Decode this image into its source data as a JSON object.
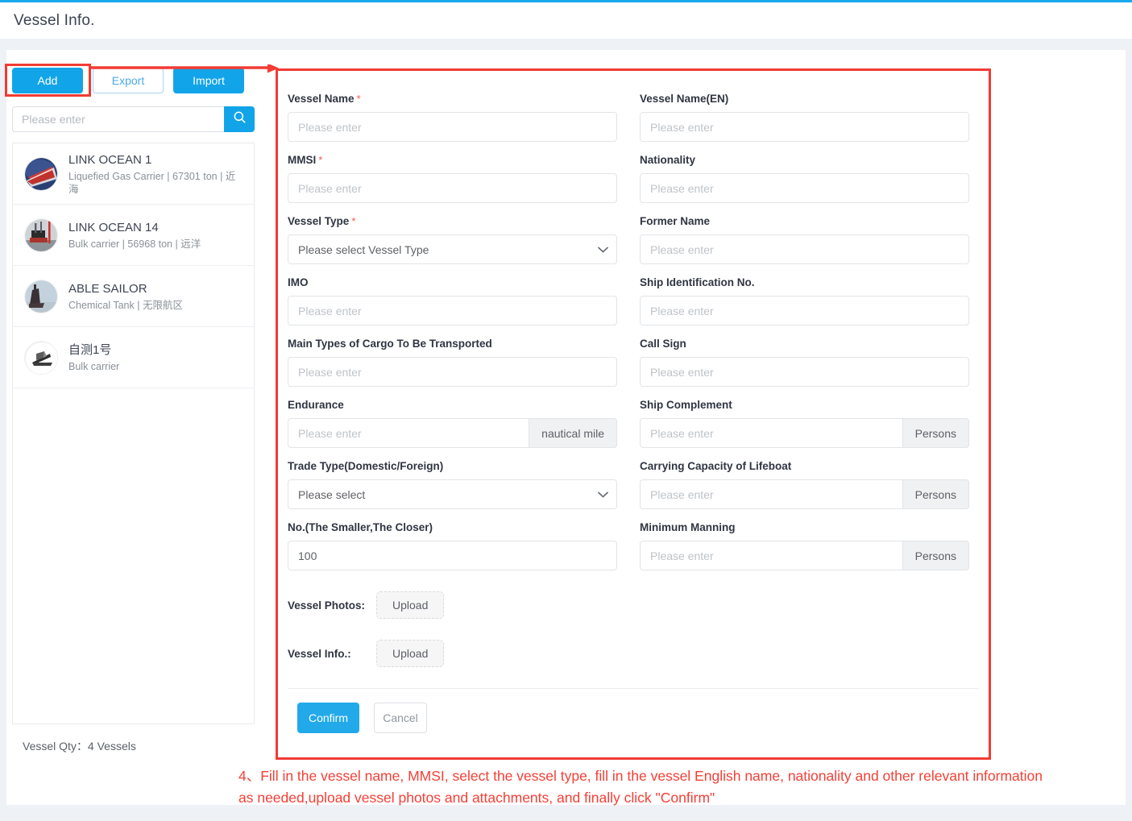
{
  "theme": {
    "accent": "#12a4e8",
    "annotation": "#f23b33",
    "required": "#f45b4e"
  },
  "header": {
    "title": "Vessel Info."
  },
  "sidebar": {
    "buttons": [
      {
        "label": "Add",
        "style": "primary",
        "name": "add-button"
      },
      {
        "label": "Export",
        "style": "ghost",
        "name": "export-button"
      },
      {
        "label": "Import",
        "style": "primary",
        "name": "import-button"
      }
    ],
    "search": {
      "placeholder": "Please enter",
      "value": "",
      "icon": "search-icon"
    },
    "vessels": [
      {
        "name": "LINK OCEAN 1",
        "meta": "Liquefied Gas Carrier | 67301 ton | 近海",
        "avatar": "vessel-photo-red-bow"
      },
      {
        "name": "LINK OCEAN 14",
        "meta": "Bulk carrier | 56968 ton | 远洋",
        "avatar": "vessel-photo-dark-mast"
      },
      {
        "name": "ABLE SAILOR",
        "meta": "Chemical Tank | 无限航区",
        "avatar": "vessel-photo-silhouette"
      },
      {
        "name": "自测1号",
        "meta": "Bulk carrier",
        "avatar": "vessel-icon-placeholder"
      }
    ],
    "footer": {
      "qty_label": "Vessel Qty：",
      "qty_value": "4 Vessels"
    }
  },
  "form": {
    "left": [
      {
        "label": "Vessel Name",
        "required": true,
        "type": "text",
        "placeholder": "Please enter",
        "value": "",
        "name": "vessel-name"
      },
      {
        "label": "MMSI",
        "required": true,
        "type": "text",
        "placeholder": "Please enter",
        "value": "",
        "name": "mmsi"
      },
      {
        "label": "Vessel Type",
        "required": true,
        "type": "select",
        "placeholder": "Please select Vessel Type",
        "value": "Please select Vessel Type",
        "name": "vessel-type"
      },
      {
        "label": "IMO",
        "required": false,
        "type": "text",
        "placeholder": "Please enter",
        "value": "",
        "name": "imo"
      },
      {
        "label": "Main Types of Cargo To Be Transported",
        "required": false,
        "type": "text",
        "placeholder": "Please enter",
        "value": "",
        "name": "main-cargo-types"
      },
      {
        "label": "Endurance",
        "required": false,
        "type": "text-unit",
        "placeholder": "Please enter",
        "value": "",
        "unit": "nautical mile",
        "name": "endurance"
      },
      {
        "label": "Trade Type(Domestic/Foreign)",
        "required": false,
        "type": "select",
        "placeholder": "Please select",
        "value": "Please select",
        "name": "trade-type"
      },
      {
        "label": "No.(The Smaller,The Closer)",
        "required": false,
        "type": "text",
        "placeholder": "100",
        "value": "100",
        "name": "order-no"
      }
    ],
    "right": [
      {
        "label": "Vessel Name(EN)",
        "required": false,
        "type": "text",
        "placeholder": "Please enter",
        "value": "",
        "name": "vessel-name-en"
      },
      {
        "label": "Nationality",
        "required": false,
        "type": "text",
        "placeholder": "Please enter",
        "value": "",
        "name": "nationality"
      },
      {
        "label": "Former Name",
        "required": false,
        "type": "text",
        "placeholder": "Please enter",
        "value": "",
        "name": "former-name"
      },
      {
        "label": "Ship Identification No.",
        "required": false,
        "type": "text",
        "placeholder": "Please enter",
        "value": "",
        "name": "ship-identification-no"
      },
      {
        "label": "Call Sign",
        "required": false,
        "type": "text",
        "placeholder": "Please enter",
        "value": "",
        "name": "call-sign"
      },
      {
        "label": "Ship Complement",
        "required": false,
        "type": "text-unit",
        "placeholder": "Please enter",
        "value": "",
        "unit": "Persons",
        "name": "ship-complement"
      },
      {
        "label": "Carrying Capacity of Lifeboat",
        "required": false,
        "type": "text-unit",
        "placeholder": "Please enter",
        "value": "",
        "unit": "Persons",
        "name": "lifeboat-capacity"
      },
      {
        "label": "Minimum Manning",
        "required": false,
        "type": "text-unit",
        "placeholder": "Please enter",
        "value": "",
        "unit": "Persons",
        "name": "minimum-manning"
      }
    ],
    "uploads": [
      {
        "label": "Vessel Photos:",
        "button": "Upload",
        "name": "vessel-photos"
      },
      {
        "label": "Vessel Info.:",
        "button": "Upload",
        "name": "vessel-info-file"
      }
    ],
    "actions": {
      "confirm": "Confirm",
      "cancel": "Cancel"
    }
  },
  "annotation": {
    "text": "4、Fill in the vessel name, MMSI, select the vessel type, fill in the vessel English name, nationality and other relevant information as needed,upload vessel photos and attachments, and finally click \"Confirm\""
  }
}
